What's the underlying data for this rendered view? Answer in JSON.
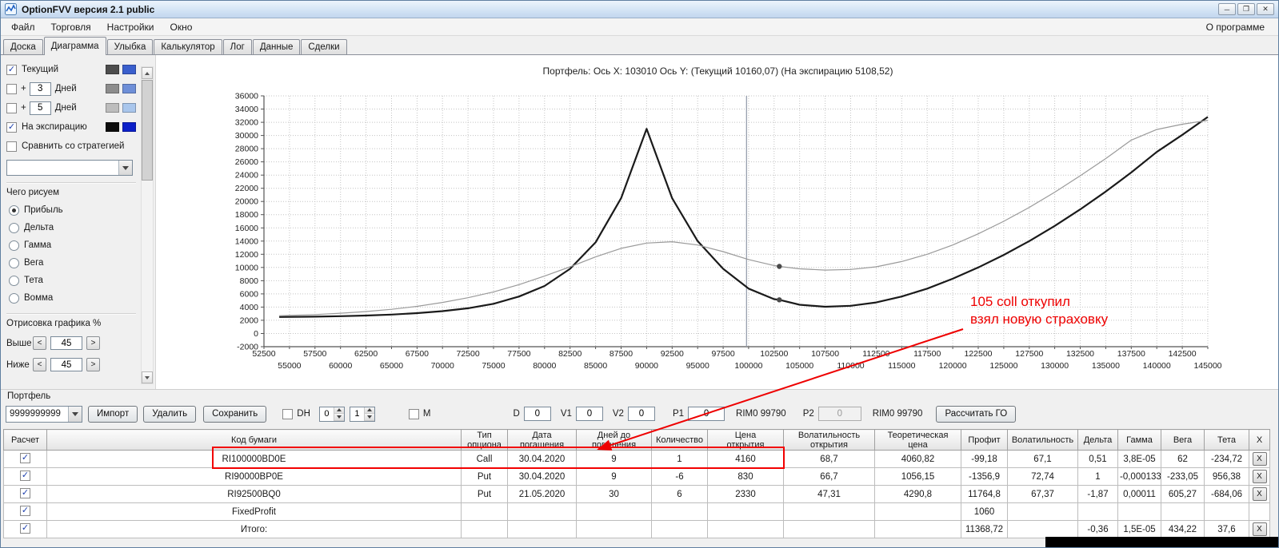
{
  "window": {
    "title": "OptionFVV версия 2.1 public",
    "controls": {
      "minimize": "─",
      "maximize": "❐",
      "close": "✕"
    }
  },
  "menu": {
    "items": [
      "Файл",
      "Торговля",
      "Настройки",
      "Окно"
    ],
    "right": "О программе"
  },
  "tabs": {
    "items": [
      "Доска",
      "Диаграмма",
      "Улыбка",
      "Калькулятор",
      "Лог",
      "Данные",
      "Сделки"
    ],
    "active": "Диаграмма"
  },
  "sidebar": {
    "series_toggles": [
      {
        "label": "Текущий",
        "check": "✓",
        "prefix": "",
        "days": "",
        "colors": [
          "#4d4d4d",
          "#3a5fcd"
        ]
      },
      {
        "label": "Дней",
        "check": "",
        "prefix": "+",
        "days": "3",
        "colors": [
          "#8c8c8c",
          "#6e8fd8"
        ]
      },
      {
        "label": "Дней",
        "check": "",
        "prefix": "+",
        "days": "5",
        "colors": [
          "#bdbdbd",
          "#a9c6ec"
        ]
      },
      {
        "label": "На экспирацию",
        "check": "✓",
        "prefix": "",
        "days": "",
        "colors": [
          "#0d0d0d",
          "#0b1fc8"
        ]
      }
    ],
    "compare": {
      "label": "Сравнить со стратегией",
      "check": ""
    },
    "strategy_value": "",
    "draw_group": {
      "label": "Чего рисуем",
      "options": [
        "Прибыль",
        "Дельта",
        "Гамма",
        "Вега",
        "Тета",
        "Вомма"
      ],
      "selected": "Прибыль"
    },
    "render_group": {
      "label": "Отрисовка графика %",
      "above_label": "Выше",
      "above_value": "45",
      "below_label": "Ниже",
      "below_value": "45",
      "dec": "<",
      "inc": ">"
    }
  },
  "chart": {
    "title": "Портфель: Ось X: 103010 Ось Y:  (Текущий 10160,07)  (На экспирацию 5108,52)"
  },
  "chart_data": {
    "type": "line",
    "title": "Портфель: Ось X: 103010 Ось Y: (Текущий 10160,07) (На экспирацию 5108,52)",
    "xlabel": "",
    "ylabel": "",
    "xlim": [
      52500,
      145000
    ],
    "ylim": [
      -2000,
      36000
    ],
    "x_tick_step": 2500,
    "y_tick_step": 2000,
    "grid": true,
    "vline_x": 99790,
    "markers": [
      {
        "x": 103010,
        "y": 10160.07,
        "label": "Текущий"
      },
      {
        "x": 103010,
        "y": 5108.52,
        "label": "На экспирацию"
      }
    ],
    "series": [
      {
        "name": "На экспирацию",
        "color": "#1a1a1a",
        "width": 2.2,
        "points": [
          [
            54000,
            2500
          ],
          [
            57500,
            2550
          ],
          [
            60000,
            2620
          ],
          [
            62500,
            2720
          ],
          [
            65000,
            2870
          ],
          [
            67500,
            3080
          ],
          [
            70000,
            3380
          ],
          [
            72500,
            3820
          ],
          [
            75000,
            4500
          ],
          [
            77500,
            5600
          ],
          [
            80000,
            7200
          ],
          [
            82500,
            9800
          ],
          [
            85000,
            13800
          ],
          [
            87500,
            20500
          ],
          [
            90000,
            31000
          ],
          [
            92500,
            20500
          ],
          [
            95000,
            14000
          ],
          [
            97500,
            9800
          ],
          [
            100000,
            6800
          ],
          [
            102500,
            5200
          ],
          [
            103010,
            5108
          ],
          [
            105000,
            4350
          ],
          [
            107500,
            4050
          ],
          [
            110000,
            4200
          ],
          [
            112500,
            4700
          ],
          [
            115000,
            5600
          ],
          [
            117500,
            6800
          ],
          [
            120000,
            8300
          ],
          [
            122500,
            10000
          ],
          [
            125000,
            11900
          ],
          [
            127500,
            14000
          ],
          [
            130000,
            16300
          ],
          [
            132500,
            18800
          ],
          [
            135000,
            21500
          ],
          [
            137500,
            24400
          ],
          [
            140000,
            27500
          ],
          [
            142500,
            30100
          ],
          [
            145000,
            32800
          ]
        ]
      },
      {
        "name": "Текущий",
        "color": "#9a9a9a",
        "width": 1.2,
        "points": [
          [
            54000,
            2700
          ],
          [
            57500,
            2870
          ],
          [
            60000,
            3070
          ],
          [
            62500,
            3320
          ],
          [
            65000,
            3660
          ],
          [
            67500,
            4110
          ],
          [
            70000,
            4700
          ],
          [
            72500,
            5420
          ],
          [
            75000,
            6300
          ],
          [
            77500,
            7400
          ],
          [
            80000,
            8700
          ],
          [
            82500,
            10100
          ],
          [
            85000,
            11600
          ],
          [
            87500,
            12900
          ],
          [
            90000,
            13700
          ],
          [
            92500,
            13900
          ],
          [
            95000,
            13400
          ],
          [
            97500,
            12400
          ],
          [
            100000,
            11200
          ],
          [
            102500,
            10300
          ],
          [
            103010,
            10160
          ],
          [
            105000,
            9800
          ],
          [
            107500,
            9600
          ],
          [
            110000,
            9700
          ],
          [
            112500,
            10100
          ],
          [
            115000,
            10900
          ],
          [
            117500,
            12000
          ],
          [
            120000,
            13400
          ],
          [
            122500,
            15100
          ],
          [
            125000,
            17000
          ],
          [
            127500,
            19100
          ],
          [
            130000,
            21400
          ],
          [
            132500,
            23900
          ],
          [
            135000,
            26500
          ],
          [
            137500,
            29300
          ],
          [
            140000,
            30900
          ],
          [
            142500,
            31700
          ],
          [
            145000,
            32300
          ]
        ]
      }
    ],
    "annotation": {
      "lines": [
        "105 coll откупил",
        "взял новую страховку"
      ],
      "color": "#ee0000"
    }
  },
  "portfolio": {
    "label": "Портфель",
    "account_value": "9999999999",
    "import_btn": "Импорт",
    "delete_btn": "Удалить",
    "save_btn": "Сохранить",
    "dh": {
      "label": "DH",
      "check": "",
      "spin1": "0",
      "spin2": "1"
    },
    "m": {
      "label": "M",
      "check": ""
    },
    "d_label": "D",
    "d_value": "0",
    "v1_label": "V1",
    "v1_value": "0",
    "v2_label": "V2",
    "v2_value": "0",
    "p1_label": "P1",
    "p1_value": "0",
    "rim0_label_1": "RIM0 99790",
    "p2_label": "P2",
    "p2_value": "0",
    "rim0_label_2": "RIM0 99790",
    "calc_btn": "Рассчитать ГО"
  },
  "table": {
    "check_glyph": "✓",
    "close_label": "X",
    "headers": [
      "Расчет",
      "Код бумаги",
      "Тип\nопциона",
      "Дата\nпогашения",
      "Дней до\nпогашения",
      "Количество",
      "Цена\nоткрытия",
      "Волатильность\nоткрытия",
      "Теоретическая\nцена",
      "Профит",
      "Волатильность",
      "Дельта",
      "Гамма",
      "Вега",
      "Тета",
      "X"
    ],
    "rows": [
      {
        "checked": true,
        "selected": false,
        "profit_color": "pink",
        "dark_right": false,
        "cells": [
          "RI100000BD0E",
          "Call",
          "30.04.2020",
          "9",
          "1",
          "4160",
          "68,7",
          "4060,82",
          "-99,18",
          "67,1",
          "0,51",
          "3,8E-05",
          "62",
          "-234,72"
        ]
      },
      {
        "checked": true,
        "selected": true,
        "profit_color": "pink",
        "dark_right": false,
        "cells": [
          "RI90000BP0E",
          "Put",
          "30.04.2020",
          "9",
          "-6",
          "830",
          "66,7",
          "1056,15",
          "-1356,9",
          "72,74",
          "1",
          "-0,000133",
          "-233,05",
          "956,38"
        ]
      },
      {
        "checked": true,
        "selected": false,
        "profit_color": "green",
        "dark_right": false,
        "cells": [
          "RI92500BQ0",
          "Put",
          "21.05.2020",
          "30",
          "6",
          "2330",
          "47,31",
          "4290,8",
          "11764,8",
          "67,37",
          "-1,87",
          "0,00011",
          "605,27",
          "-684,06"
        ]
      },
      {
        "checked": true,
        "selected": false,
        "profit_color": "green",
        "dark_right": true,
        "cells": [
          "FixedProfit",
          "",
          "",
          "",
          "",
          "",
          "",
          "",
          "1060",
          "",
          "",
          "",
          "",
          ""
        ]
      },
      {
        "checked": true,
        "selected": false,
        "profit_color": "green",
        "dark_right": false,
        "cells": [
          "Итого:",
          "",
          "",
          "",
          "",
          "",
          "",
          "",
          "11368,72",
          "",
          "-0,36",
          "1,5E-05",
          "434,22",
          "37,6"
        ]
      }
    ]
  }
}
